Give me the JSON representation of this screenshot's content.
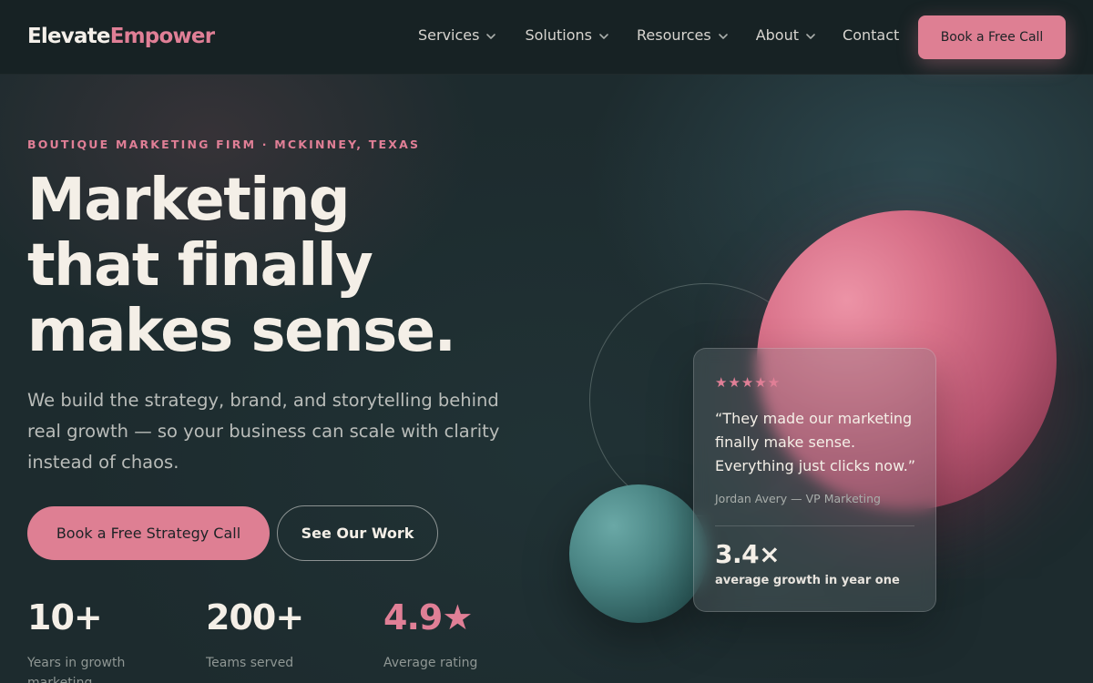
{
  "nav": {
    "logo_part1": "Elevate",
    "logo_part2": "Empower",
    "items": [
      {
        "label": "Services",
        "has_dropdown": true
      },
      {
        "label": "Solutions",
        "has_dropdown": true
      },
      {
        "label": "Resources",
        "has_dropdown": true
      },
      {
        "label": "About",
        "has_dropdown": true
      },
      {
        "label": "Contact",
        "has_dropdown": false
      }
    ],
    "cta_label": "Book a Free Call"
  },
  "hero": {
    "eyebrow": "BOUTIQUE MARKETING FIRM · MCKINNEY, TEXAS",
    "headline_lines": [
      "Marketing",
      "that finally",
      "makes sense."
    ],
    "subheading": "We build the strategy, brand, and storytelling behind real growth — so your business can scale with clarity instead of chaos.",
    "primary_cta": "Book a Free Strategy Call",
    "secondary_cta": "See Our Work"
  },
  "stats": [
    {
      "value": "10+",
      "label": "Years in growth marketing"
    },
    {
      "value": "200+",
      "label": "Teams served"
    },
    {
      "value": "4.9★",
      "label": "Average rating"
    }
  ],
  "testimonial": {
    "stars": "★★★★★",
    "rating": 5,
    "quote": "“They made our marketing finally make sense. Everything just clicks now.”",
    "author": "Jordan Avery — VP Marketing",
    "metric_value": "3.4×",
    "metric_label": "average growth in year one"
  },
  "colors": {
    "accent": "#de7f93",
    "background": "#1d2b2e",
    "nav_background": "#172224",
    "teal": "#4a8584"
  }
}
